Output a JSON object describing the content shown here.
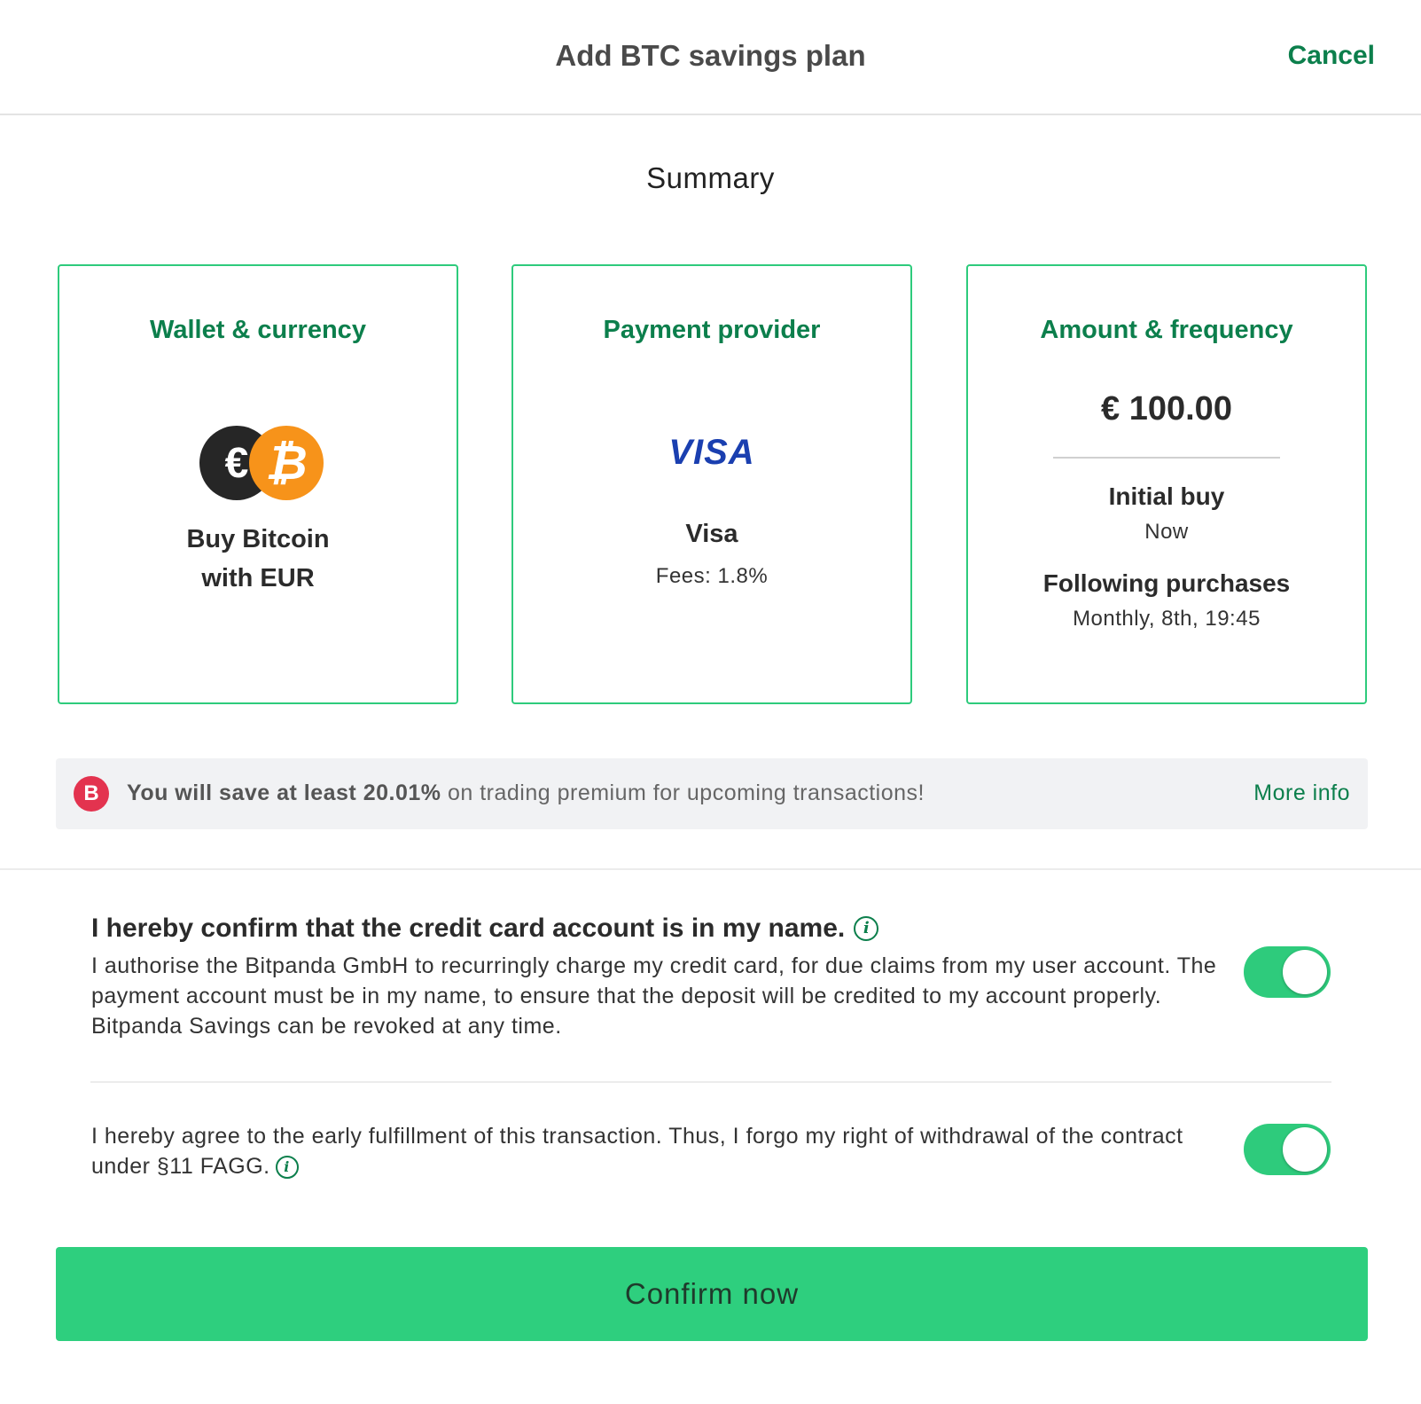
{
  "header": {
    "title": "Add BTC savings plan",
    "cancel_label": "Cancel"
  },
  "summary": {
    "title": "Summary"
  },
  "cards": {
    "wallet": {
      "title": "Wallet & currency",
      "eur_symbol": "€",
      "btc_symbol": "₿",
      "line1": "Buy Bitcoin",
      "line2": "with EUR"
    },
    "payment": {
      "title": "Payment provider",
      "logo_text": "VISA",
      "name": "Visa",
      "fees": "Fees: 1.8%"
    },
    "amount": {
      "title": "Amount & frequency",
      "value": "€ 100.00",
      "initial_label": "Initial buy",
      "initial_value": "Now",
      "following_label": "Following purchases",
      "following_value": "Monthly, 8th, 19:45"
    }
  },
  "banner": {
    "icon": "bitpanda-best-icon",
    "icon_glyph": "B",
    "bold_text": "You will save at least 20.01%",
    "text": " on trading premium for upcoming transactions!",
    "more_info": "More info"
  },
  "consents": [
    {
      "title": "I hereby confirm that the credit card account is in my name.",
      "body": "I authorise the Bitpanda GmbH to recurringly charge my credit card, for due claims from my user account. The payment account must be in my name, to ensure that the deposit will be credited to my account properly. Bitpanda Savings can be revoked at any time.",
      "checked": true
    },
    {
      "title": "",
      "body": "I hereby agree to the early fulfillment of this transaction. Thus, I forgo my right of withdrawal of the contract under §11 FAGG.",
      "checked": true
    }
  ],
  "info_glyph": "i",
  "confirm_label": "Confirm now",
  "colors": {
    "accent_green": "#2ecb7c",
    "text_green": "#0c7f4c",
    "visa_blue": "#1a3fb0",
    "btc_orange": "#f7931a",
    "bitpanda_red": "#e3334f"
  }
}
